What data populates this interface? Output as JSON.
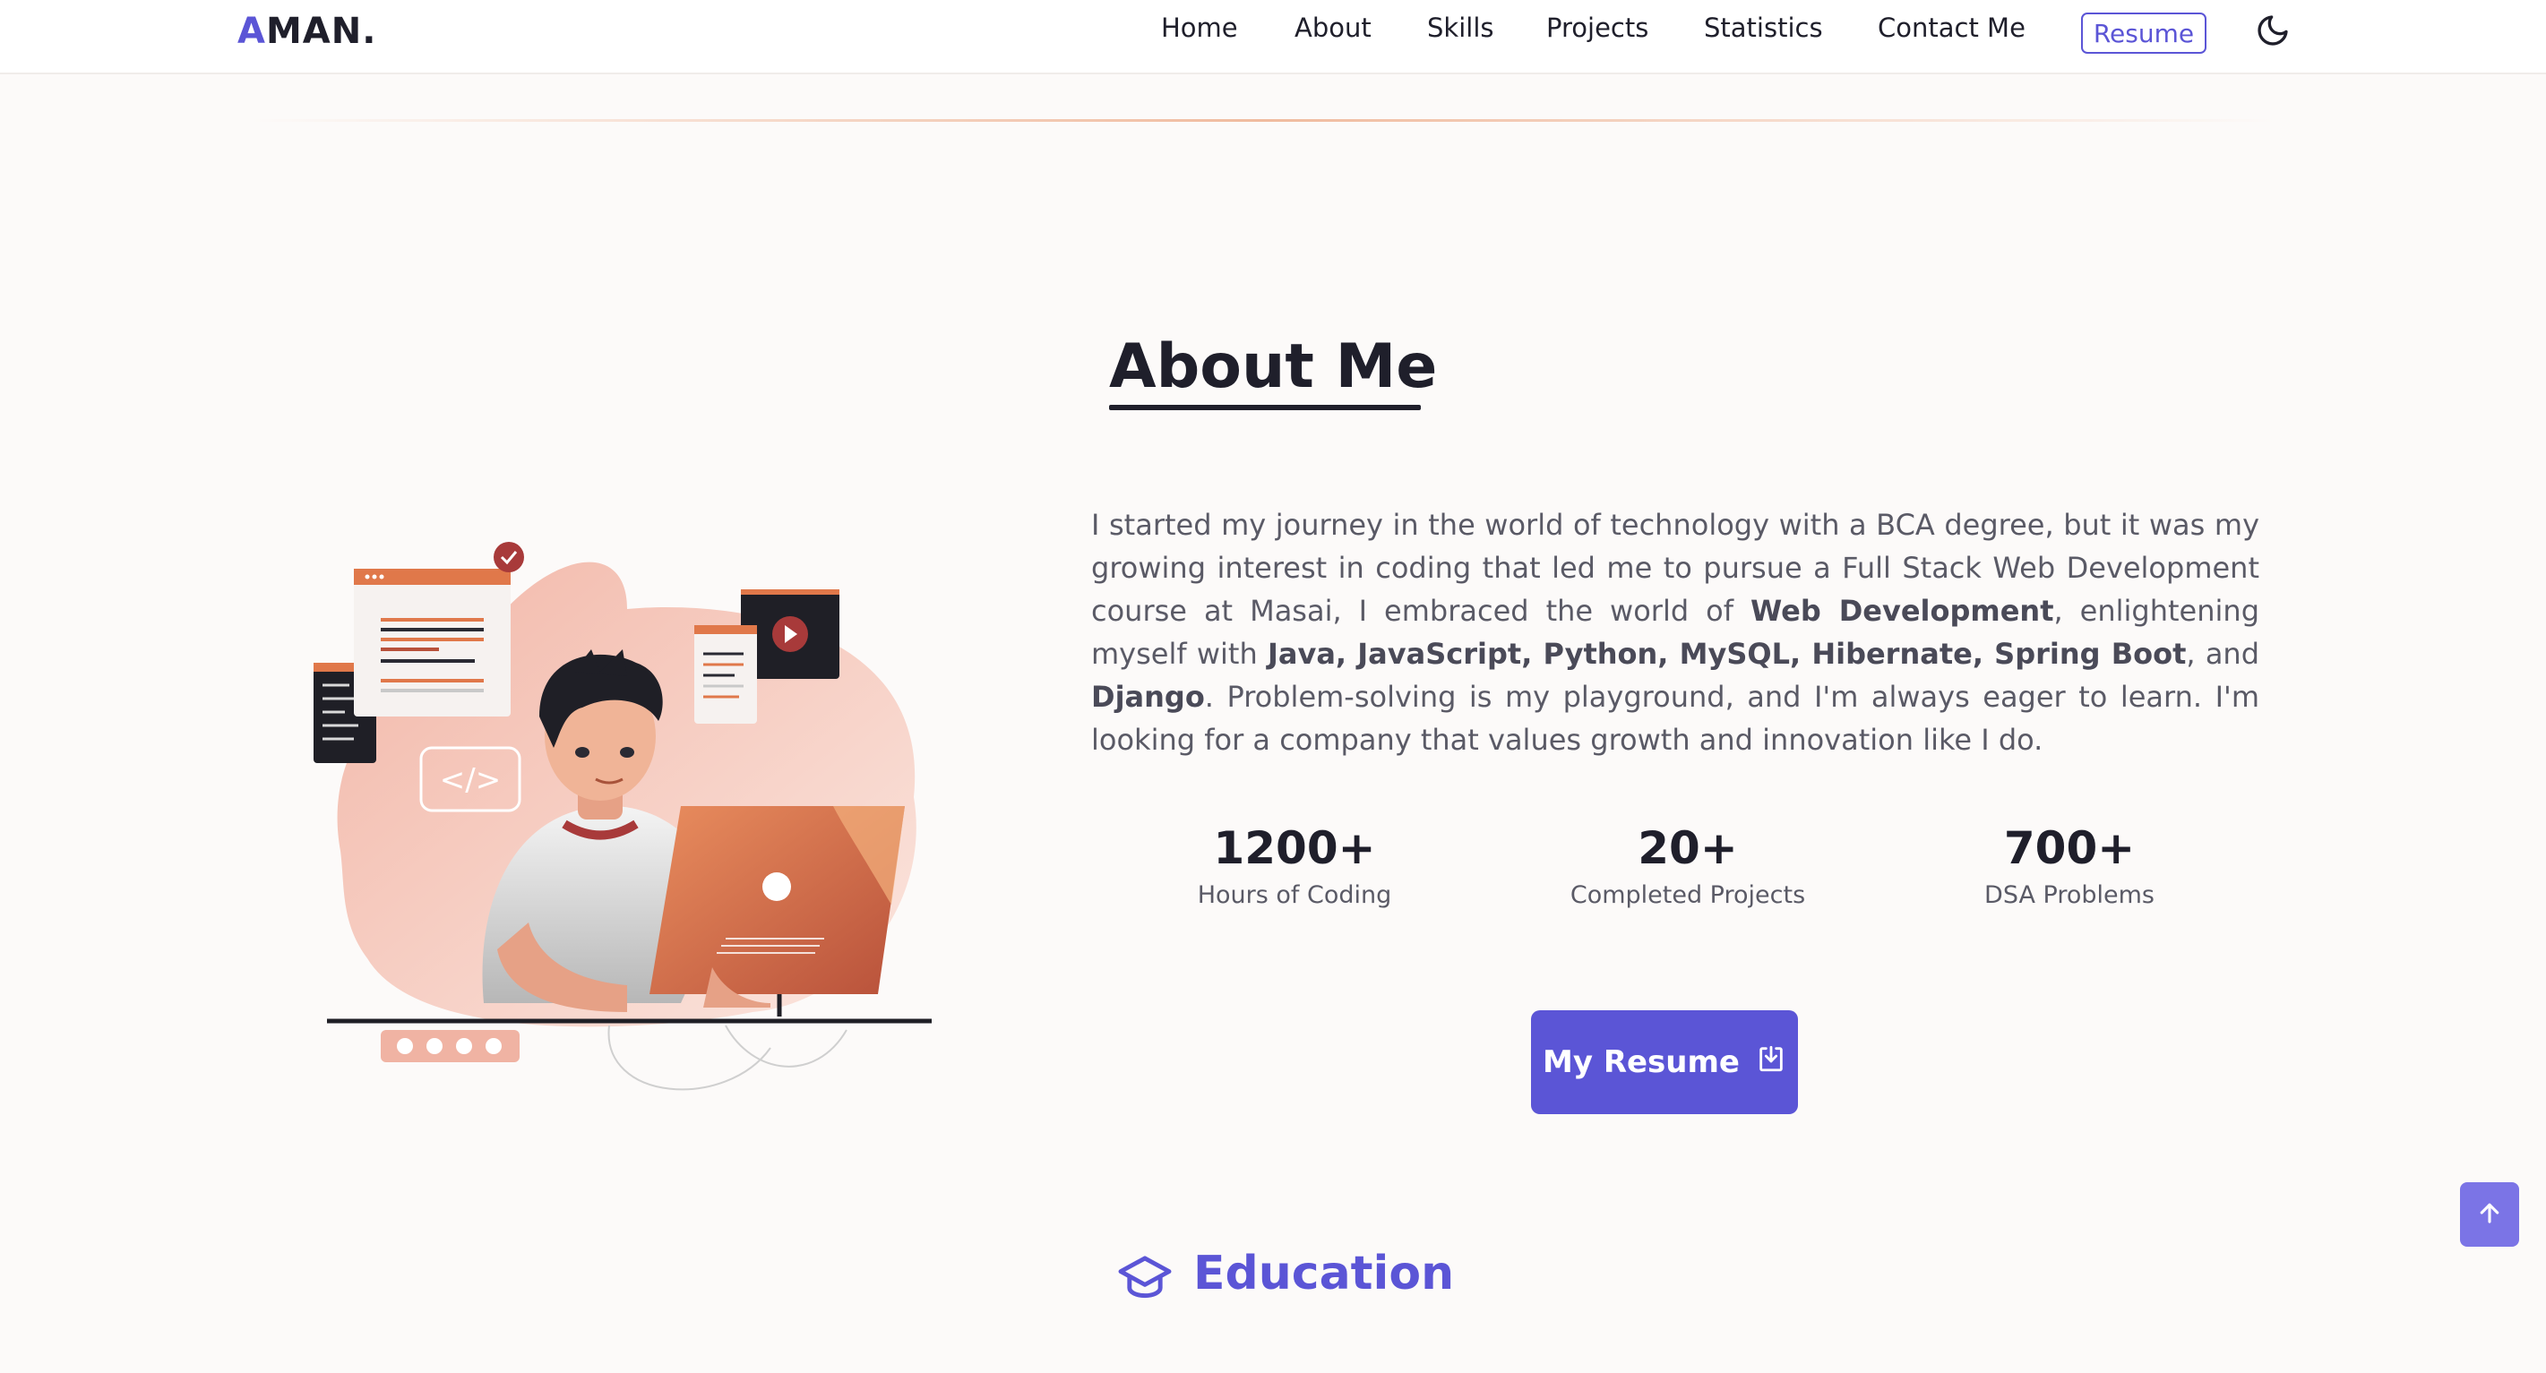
{
  "header": {
    "logo_first": "A",
    "logo_rest": "MAN.",
    "nav": [
      {
        "label": "Home"
      },
      {
        "label": "About"
      },
      {
        "label": "Skills"
      },
      {
        "label": "Projects"
      },
      {
        "label": "Statistics"
      },
      {
        "label": "Contact Me"
      }
    ],
    "resume_label": "Resume",
    "theme_icon": "moon-icon"
  },
  "about": {
    "title": "About Me",
    "bio": {
      "intro": "I started my journey in the world of technology with a BCA degree, but it was my growing interest in coding that led me to pursue a Full Stack Web Development course at Masai, I embraced the world of ",
      "web_dev": "Web Development",
      "mid": ", enlightening myself with ",
      "techs": "Java, JavaScript, Python, MySQL, Hibernate, Spring Boot",
      "and": ", and ",
      "django": "Django",
      "outro": ". Problem-solving is my playground, and I'm always eager to learn. I'm looking for a company that values growth and innovation like I do."
    },
    "stats": [
      {
        "value": "1200+",
        "label": "Hours of Coding"
      },
      {
        "value": "20+",
        "label": "Completed Projects"
      },
      {
        "value": "700+",
        "label": "DSA Problems"
      }
    ],
    "resume_button": "My Resume",
    "resume_button_icon": "download-icon"
  },
  "education": {
    "title": "Education",
    "icon": "graduation-cap-icon"
  },
  "scroll_top_icon": "arrow-up-icon",
  "colors": {
    "accent": "#5b55d6",
    "background": "#fcfaf9",
    "illustration_orange": "#e0784a"
  }
}
